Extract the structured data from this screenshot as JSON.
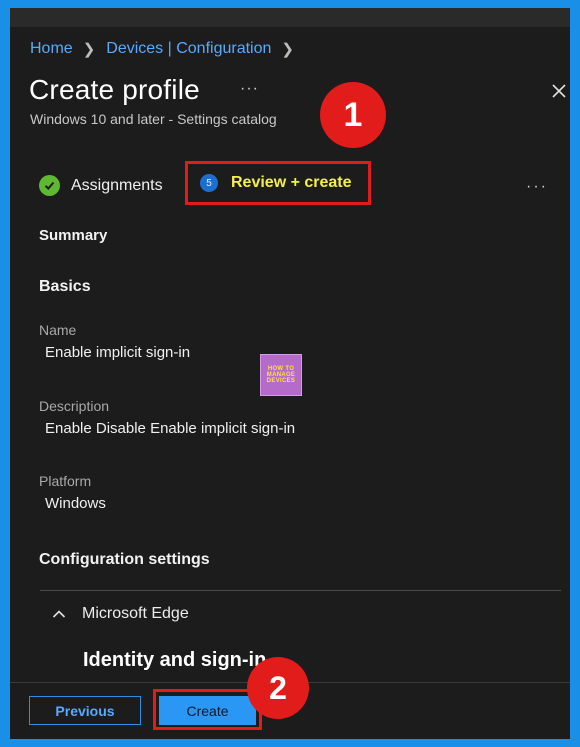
{
  "breadcrumb": {
    "items": [
      "Home",
      "Devices | Configuration"
    ]
  },
  "header": {
    "title": "Create profile",
    "more": "···",
    "subtitle": "Windows 10 and later - Settings catalog"
  },
  "annotations": {
    "badge1": "1",
    "badge2": "2"
  },
  "wizard": {
    "step_assignments": "Assignments",
    "step_review_number": "5",
    "step_review": "Review + create",
    "more": "···"
  },
  "summary": {
    "heading": "Summary",
    "basics_heading": "Basics",
    "fields": [
      {
        "label": "Name",
        "value": "Enable implicit sign-in"
      },
      {
        "label": "Description",
        "value": "Enable Disable Enable implicit sign-in"
      },
      {
        "label": "Platform",
        "value": "Windows"
      }
    ]
  },
  "watermark": {
    "line1": "HOW TO",
    "line2": "MANAGE",
    "line3": "DEVICES"
  },
  "configuration": {
    "heading": "Configuration settings",
    "group": "Microsoft Edge",
    "subheading": "Identity and sign-in"
  },
  "footer": {
    "previous_label": "Previous",
    "create_label": "Create"
  },
  "colors": {
    "frame": "#1a8fe8",
    "panel": "#1c1c1c",
    "link": "#5aa9ff",
    "highlight_text": "#f4ef4a",
    "annotation_red": "#e21b1b",
    "check_green": "#5fb832",
    "primary_button": "#2a97f5"
  }
}
